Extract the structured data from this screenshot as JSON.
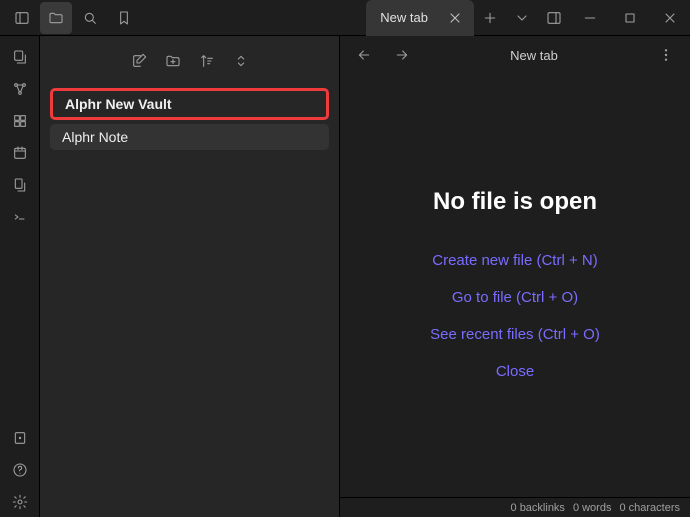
{
  "tab": {
    "title": "New tab"
  },
  "view": {
    "title": "New tab"
  },
  "files": {
    "items": [
      {
        "name": "Alphr New Vault"
      },
      {
        "name": "Alphr Note"
      }
    ]
  },
  "empty": {
    "heading": "No file is open",
    "actions": {
      "create": "Create new file (Ctrl + N)",
      "goto": "Go to file (Ctrl + O)",
      "recent": "See recent files (Ctrl + O)",
      "close": "Close"
    }
  },
  "status": {
    "backlinks": "0 backlinks",
    "words": "0 words",
    "chars": "0 characters"
  }
}
